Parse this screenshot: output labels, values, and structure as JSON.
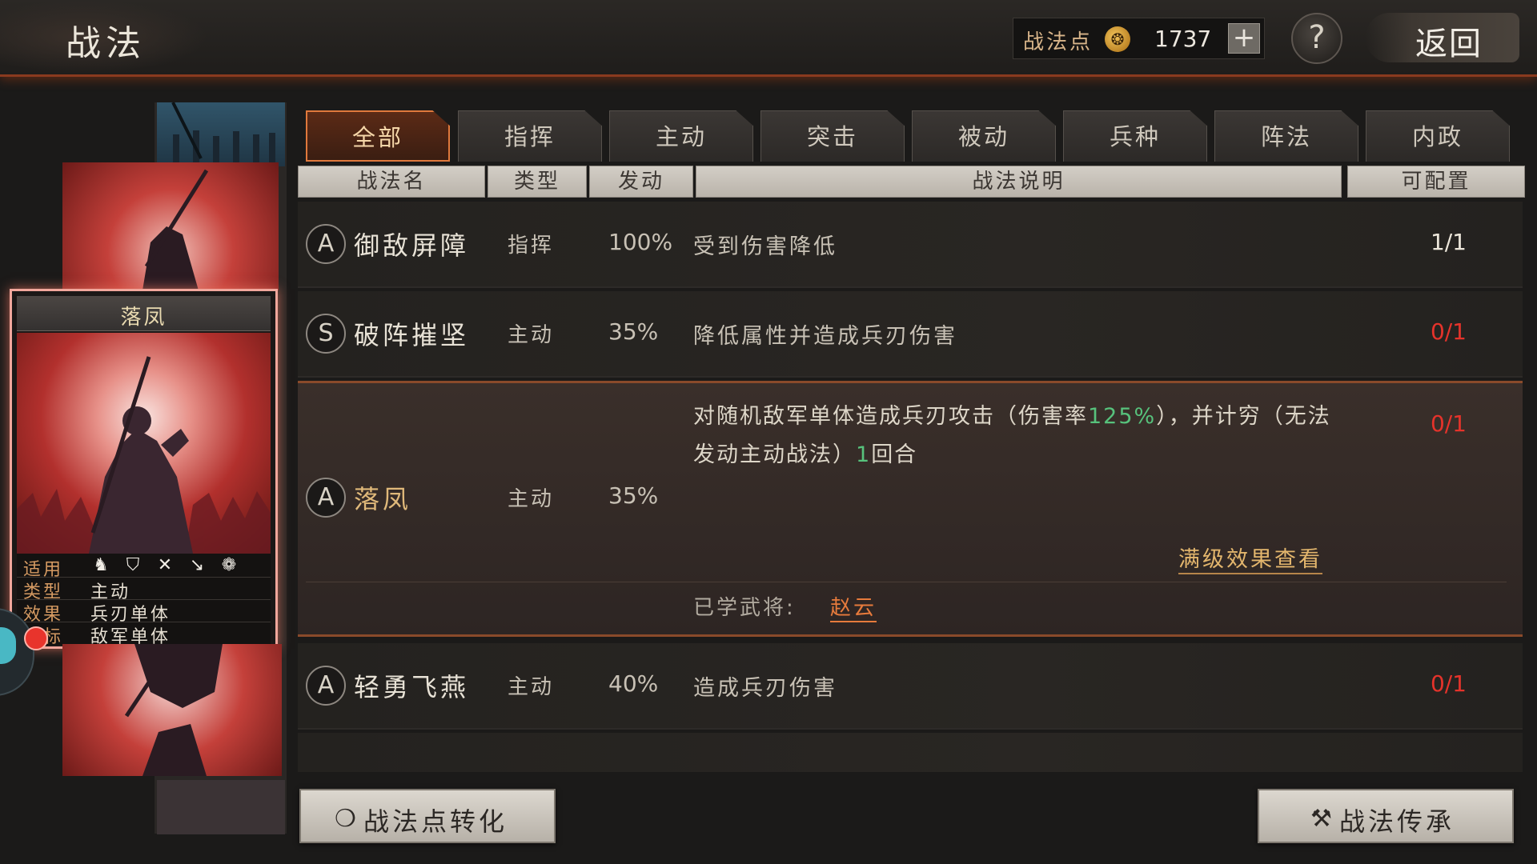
{
  "header": {
    "title": "战法",
    "points_label": "战法点",
    "points_value": "1737",
    "plus": "+",
    "help": "?",
    "back": "返回"
  },
  "tabs": [
    {
      "label": "全部",
      "active": true
    },
    {
      "label": "指挥",
      "active": false
    },
    {
      "label": "主动",
      "active": false
    },
    {
      "label": "突击",
      "active": false
    },
    {
      "label": "被动",
      "active": false
    },
    {
      "label": "兵种",
      "active": false
    },
    {
      "label": "阵法",
      "active": false
    },
    {
      "label": "内政",
      "active": false
    }
  ],
  "columns": [
    "战法名",
    "类型",
    "发动",
    "战法说明",
    "可配置"
  ],
  "skills": [
    {
      "grade": "A",
      "name": "御敌屏障",
      "type": "指挥",
      "rate": "100%",
      "desc": "受到伤害降低",
      "slots": "1/1"
    },
    {
      "grade": "S",
      "name": "破阵摧坚",
      "type": "主动",
      "rate": "35%",
      "desc": "降低属性并造成兵刃伤害",
      "slots": "0/1"
    },
    {
      "grade": "A",
      "name": "落凤",
      "type": "主动",
      "rate": "35%",
      "desc_part1": "对随机敌军单体造成兵刃攻击（伤害率",
      "desc_highlight": "125%",
      "desc_part2": "），并计穷（无法发动主动战法）",
      "desc_highlight2": "1",
      "desc_part3": "回合",
      "slots": "0/1",
      "maxlv_link": "满级效果查看",
      "learned_label": "已学武将:",
      "learned_general": "赵云"
    },
    {
      "grade": "A",
      "name": "轻勇飞燕",
      "type": "主动",
      "rate": "40%",
      "desc": "造成兵刃伤害",
      "slots": "0/1"
    }
  ],
  "card": {
    "name": "落凤",
    "apply_label": "适用",
    "apply_icons": [
      "cavalry-icon",
      "shield-icon",
      "crossed-bows-icon",
      "spear-icon",
      "wheel-icon"
    ],
    "type_label": "类型",
    "type_value": "主动",
    "effect_label": "效果",
    "effect_value": "兵刃单体",
    "target_label": "目标",
    "target_value": "敌军单体"
  },
  "buttons": {
    "convert": "战法点转化",
    "inherit": "战法传承"
  },
  "colors": {
    "accent_orange": "#e0793c",
    "slot_red": "#e5332b",
    "highlight_green": "#57c27c",
    "gold_text": "#e0b97a"
  }
}
